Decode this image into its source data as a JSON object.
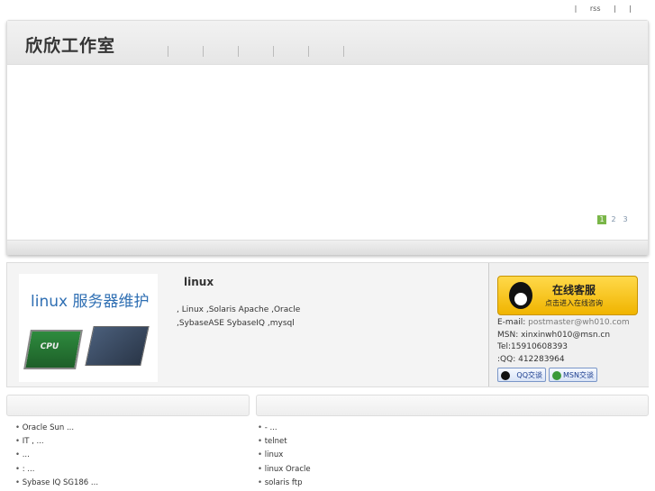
{
  "topbar": {
    "sep1": "|",
    "rss": "rss",
    "sep2": "|",
    "sep3": "|"
  },
  "header": {
    "logo": "欣欣工作室"
  },
  "slider": {
    "pages": [
      "1",
      "2",
      "3"
    ]
  },
  "info": {
    "image_text": "linux 服务器维护",
    "chip_label": "CPU",
    "title": "linux",
    "desc_line1": ", Linux     ,Solaris       Apache     ,Oracle",
    "desc_line2": ",SybaseASE SybaseIQ     ,mysql"
  },
  "service": {
    "btn_main": "在线客服",
    "btn_sub": "点击进入在线咨询",
    "email_label": "E-mail: ",
    "email": "postmaster@wh010.com",
    "msn": "MSN: xinxinwh010@msn.cn",
    "tel": "Tel:15910608393",
    "qq": ":QQ: 412283964",
    "qq_btn": "QQ交谈",
    "msn_btn": "MSN交谈"
  },
  "left_list": [
    "Oracle Sun          ...",
    "     IT    ,     ...",
    "              ...",
    "   :          ...",
    "Sybase IQ     SG186    ..."
  ],
  "right_list": [
    "          -    ...",
    "telnet",
    "linux",
    "linux Oracle",
    "solaris ftp"
  ],
  "colors": {
    "accent_green": "#7ab648",
    "link_blue": "#2f6fb3",
    "kefu_yellow": "#f0b400"
  }
}
